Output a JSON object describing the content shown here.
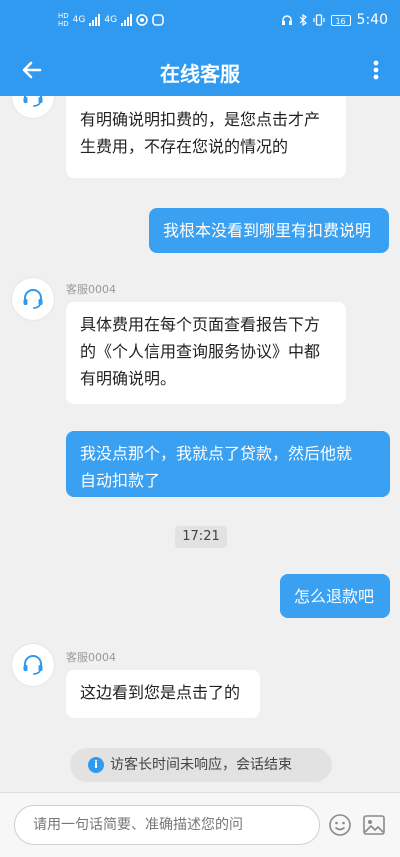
{
  "status_bar": {
    "hd_top": "HD",
    "hd_bottom": "HD",
    "net1": "4G",
    "net2": "4G",
    "battery": "16",
    "time": "5:40"
  },
  "header": {
    "title": "在线客服"
  },
  "messages": {
    "m1": {
      "lines": [
        "有明确说明扣费的，是您点击才产",
        "生费用，不存在您说的情况的"
      ]
    },
    "m2": {
      "text": "我根本没看到哪里有扣费说明"
    },
    "m3": {
      "name": "客服0004",
      "lines": [
        "具体费用在每个页面查看报告下方",
        "的《个人信用查询服务协议》中都",
        "有明确说明。"
      ]
    },
    "m4": {
      "lines": [
        "我没点那个，我就点了贷款，然后他就",
        "自动扣款了"
      ]
    },
    "time_divider": "17:21",
    "m5": {
      "text": "怎么退款吧"
    },
    "m6": {
      "name": "客服0004",
      "text": "这边看到您是点击了的"
    },
    "notice": "访客长时间未响应，会话结束"
  },
  "composer": {
    "placeholder": "请用一句话简要、准确描述您的问"
  },
  "colors": {
    "brand": "#2f9af0",
    "user_bubble": "#39a0f2"
  },
  "icons": {
    "back": "back-arrow-icon",
    "more": "more-vertical-icon",
    "agent": "headset-icon",
    "info": "info-icon",
    "emoji": "emoji-icon",
    "image": "image-icon"
  }
}
